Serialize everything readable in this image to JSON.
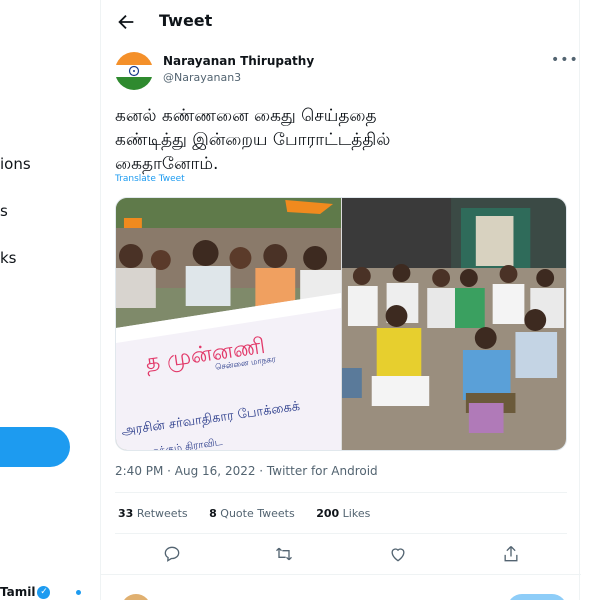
{
  "sidebar": {
    "items": [
      {
        "label": "ions"
      },
      {
        "label": "s"
      },
      {
        "label": "ks"
      }
    ],
    "account": {
      "name": "Tamil"
    }
  },
  "header": {
    "title": "Tweet"
  },
  "tweet": {
    "author_name": "Narayanan Thirupathy",
    "author_handle": "@Narayanan3",
    "text_line1": "கனல் கண்ணனை கைது செய்ததை",
    "text_line2": "கண்டித்து இன்றைய போராட்டத்தில்",
    "text_line3": "கைதானோம்.",
    "translate_label": "Translate Tweet",
    "timestamp": "2:40 PM · Aug 16, 2022 · Twitter for Android",
    "retweets_count": "33",
    "retweets_label": "Retweets",
    "quotes_count": "8",
    "quotes_label": "Quote Tweets",
    "likes_count": "200",
    "likes_label": "Likes"
  },
  "colors": {
    "accent": "#1d9bf0",
    "text": "#0f1419",
    "secondary": "#536471"
  }
}
